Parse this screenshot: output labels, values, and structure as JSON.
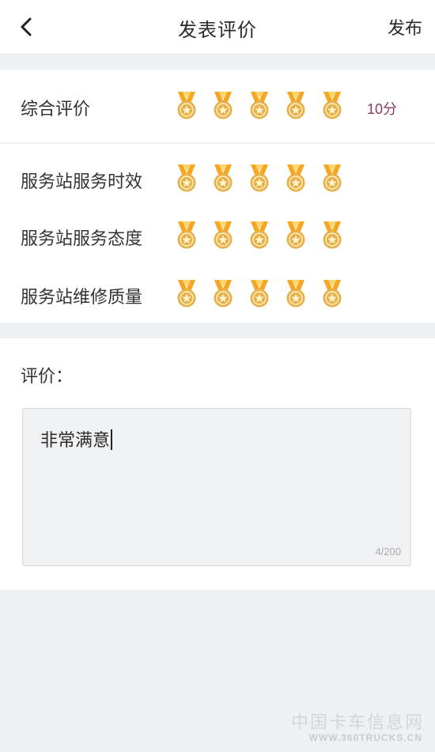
{
  "header": {
    "back_icon": "chevron-left-icon",
    "title": "发表评价",
    "publish_label": "发布"
  },
  "overall": {
    "label": "综合评价",
    "medals": 5,
    "rated": 5,
    "score_text": "10分",
    "medal_icon": "medal-icon"
  },
  "details": [
    {
      "label": "服务站服务时效",
      "rated": 5
    },
    {
      "label": "服务站服务态度",
      "rated": 5
    },
    {
      "label": "服务站维修质量",
      "rated": 5
    }
  ],
  "review": {
    "label": "评价：",
    "text": "非常满意",
    "counter": "4/200"
  },
  "watermark": {
    "cn": "中国卡车信息网",
    "en": "WWW.360TRUCKS.CN"
  },
  "colors": {
    "medal_ribbon": "#f5a623",
    "medal_body": "#e7b14a",
    "score": "#8b3a5e",
    "background": "#eef0f2"
  }
}
